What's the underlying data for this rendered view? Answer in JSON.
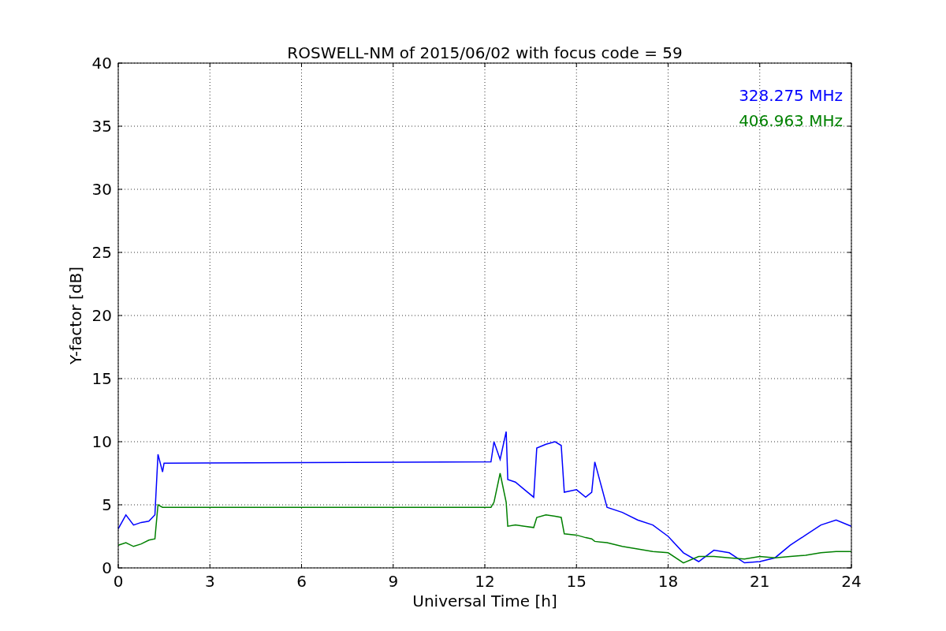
{
  "chart_data": {
    "type": "line",
    "title": "ROSWELL-NM of 2015/06/02 with focus code = 59",
    "xlabel": "Universal Time [h]",
    "ylabel": "Y-factor [dB]",
    "x": [
      0,
      0.25,
      0.5,
      0.75,
      1,
      1.2,
      1.3,
      1.45,
      1.5,
      12.2,
      12.3,
      12.5,
      12.7,
      12.75,
      13,
      13.3,
      13.6,
      13.7,
      14,
      14.3,
      14.5,
      14.6,
      15,
      15.3,
      15.5,
      15.6,
      16,
      16.5,
      17,
      17.5,
      18,
      18.5,
      19,
      19.5,
      20,
      20.5,
      21,
      21.5,
      22,
      22.5,
      23,
      23.5,
      24
    ],
    "series": [
      {
        "name": "328.275 MHz",
        "color": "#0000ff",
        "values": [
          3.1,
          4.2,
          3.4,
          3.6,
          3.7,
          4.2,
          9.0,
          7.6,
          8.3,
          8.4,
          10.0,
          8.6,
          10.8,
          7.0,
          6.8,
          6.2,
          5.6,
          9.5,
          9.8,
          10.0,
          9.7,
          6.0,
          6.2,
          5.6,
          6.0,
          8.4,
          4.8,
          4.4,
          3.8,
          3.4,
          2.5,
          1.2,
          0.5,
          1.4,
          1.2,
          0.4,
          0.5,
          0.8,
          1.8,
          2.6,
          3.4,
          3.8,
          3.3
        ]
      },
      {
        "name": "406.963 MHz",
        "color": "#008000",
        "values": [
          1.8,
          2.0,
          1.7,
          1.9,
          2.2,
          2.3,
          5.0,
          4.8,
          4.8,
          4.8,
          5.2,
          7.5,
          5.2,
          3.3,
          3.4,
          3.3,
          3.2,
          4.0,
          4.2,
          4.1,
          4.0,
          2.7,
          2.6,
          2.4,
          2.3,
          2.1,
          2.0,
          1.7,
          1.5,
          1.3,
          1.2,
          0.4,
          0.9,
          0.9,
          0.8,
          0.7,
          0.9,
          0.8,
          0.9,
          1.0,
          1.2,
          1.3,
          1.3
        ]
      }
    ],
    "grid": true,
    "xlim": [
      0,
      24
    ],
    "ylim": [
      0,
      40
    ],
    "xticks": [
      0,
      3,
      6,
      9,
      12,
      15,
      18,
      21,
      24
    ],
    "yticks": [
      0,
      5,
      10,
      15,
      20,
      25,
      30,
      35,
      40
    ]
  }
}
